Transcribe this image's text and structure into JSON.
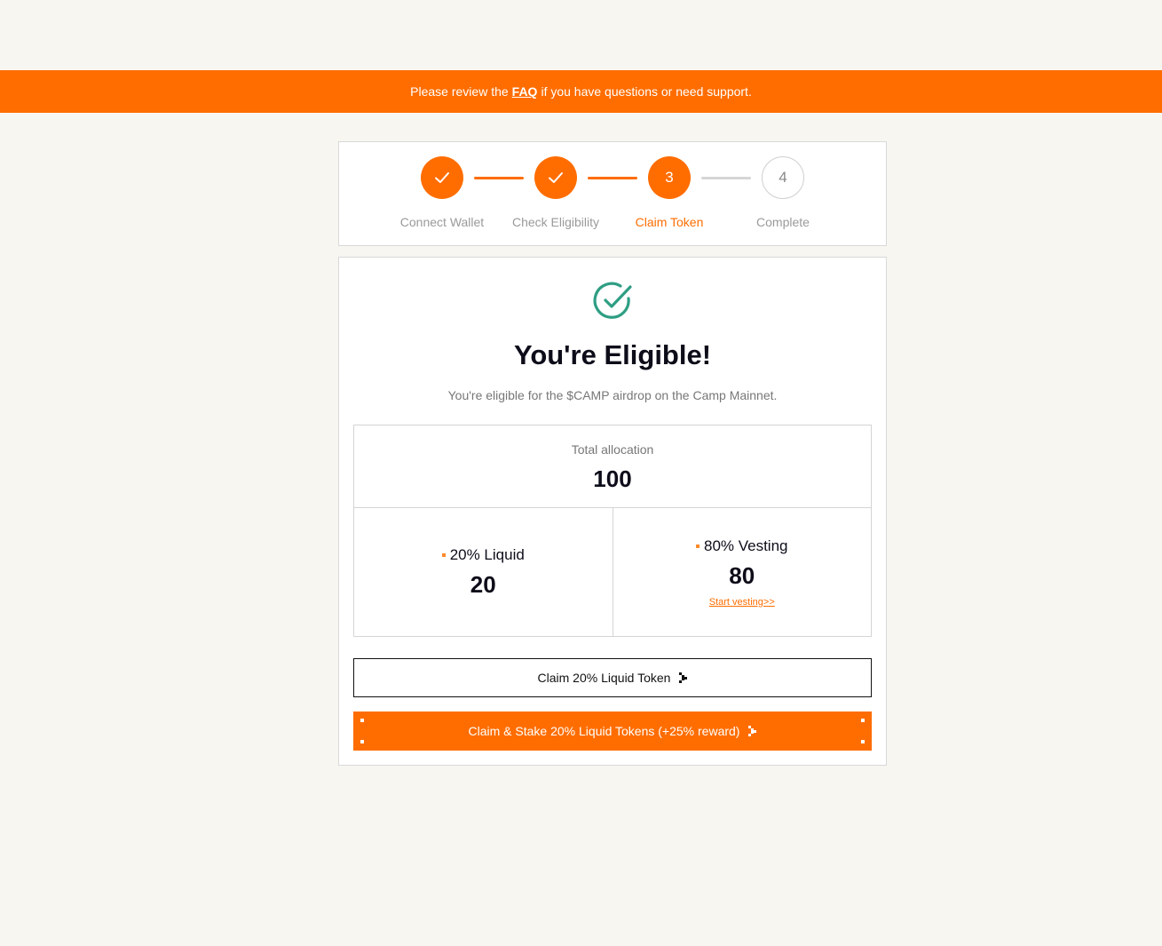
{
  "banner": {
    "prefix": "Please review the",
    "link": "FAQ",
    "suffix": "if you have questions or need support."
  },
  "steps": [
    {
      "label": "Connect Wallet",
      "state": "done",
      "number": "1"
    },
    {
      "label": "Check Eligibility",
      "state": "done",
      "number": "2"
    },
    {
      "label": "Claim Token",
      "state": "active",
      "number": "3"
    },
    {
      "label": "Complete",
      "state": "todo",
      "number": "4"
    }
  ],
  "result": {
    "title": "You're Eligible!",
    "subtitle": "You're eligible for the $CAMP airdrop on the Camp Mainnet."
  },
  "allocation": {
    "total_label": "Total allocation",
    "total_value": "100",
    "liquid_label": "20% Liquid",
    "liquid_value": "20",
    "vesting_label": "80% Vesting",
    "vesting_value": "80",
    "vesting_link": "Start vesting>>"
  },
  "buttons": {
    "claim_label": "Claim 20% Liquid Token",
    "stake_label": "Claim & Stake 20% Liquid Tokens (+25% reward)"
  },
  "colors": {
    "accent": "#ff6d00",
    "success": "#2e9e83",
    "background": "#f8f6f1"
  },
  "icons": {
    "step_done": "check-icon",
    "eligible": "check-circle-icon",
    "button": "arrow-right-icon"
  }
}
